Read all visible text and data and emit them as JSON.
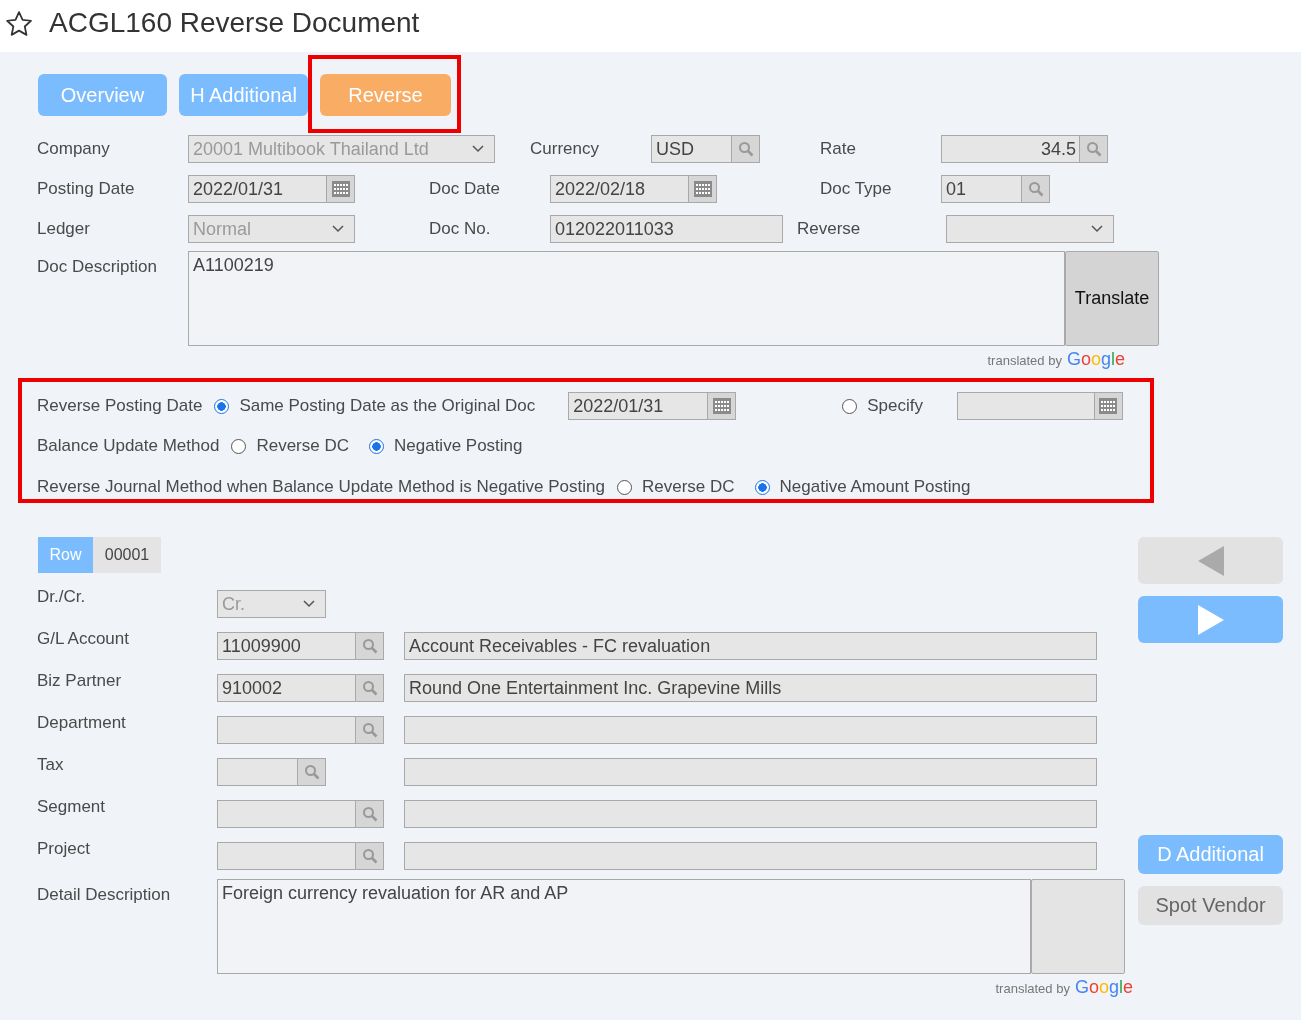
{
  "page": {
    "title": "ACGL160 Reverse Document"
  },
  "tabs": [
    {
      "label": "Overview",
      "selected": false
    },
    {
      "label": "H Additional",
      "selected": false
    },
    {
      "label": "Reverse",
      "selected": true
    }
  ],
  "header": {
    "rows": [
      [
        {
          "label": "Company",
          "kind": "select",
          "value": "20001 Multibook Thailand Ltd",
          "disabled": true
        },
        {
          "label": "Currency",
          "kind": "lookup",
          "value": "USD"
        },
        {
          "label": "Rate",
          "kind": "lookup",
          "value": "34.5"
        }
      ],
      [
        {
          "label": "Posting Date",
          "kind": "date",
          "value": "2022/01/31"
        },
        {
          "label": "Doc Date",
          "kind": "date",
          "value": "2022/02/18"
        },
        {
          "label": "Doc Type",
          "kind": "lookup",
          "value": "01"
        }
      ],
      [
        {
          "label": "Ledger",
          "kind": "select",
          "value": "Normal",
          "disabled": true
        },
        {
          "label": "Doc No.",
          "kind": "text",
          "value": "012022011033"
        },
        {
          "label": "Reverse",
          "kind": "select"
        }
      ]
    ],
    "description": {
      "label": "Doc Description",
      "value": "A1100219",
      "button": "Translate",
      "credit": "translated by",
      "logo": "Google"
    }
  },
  "reverse_options": [
    {
      "label": "Reverse Posting Date",
      "options": [
        {
          "label": "Same Posting Date as the Original Doc",
          "selected": true,
          "date": "2022/01/31"
        },
        {
          "label": "Specify",
          "selected": false
        }
      ]
    },
    {
      "label": "Balance Update Method",
      "options": [
        {
          "label": "Reverse DC",
          "selected": false
        },
        {
          "label": "Negative Posting",
          "selected": true
        }
      ]
    },
    {
      "label": "Reverse Journal Method when Balance Update Method is Negative Posting",
      "options": [
        {
          "label": "Reverse DC",
          "selected": false
        },
        {
          "label": "Negative Amount Posting",
          "selected": true
        }
      ]
    }
  ],
  "detail": {
    "row_label": "Row",
    "row_number": "00001",
    "fields": [
      {
        "label": "Dr./Cr.",
        "kind": "select",
        "value": "Cr.",
        "disabled": true
      },
      {
        "label": "G/L Account",
        "kind": "lookup",
        "value": "11009900",
        "name": "Account Receivables - FC revaluation"
      },
      {
        "label": "Biz Partner",
        "kind": "lookup",
        "value": "910002",
        "name": "Round One Entertainment Inc. Grapevine Mills"
      },
      {
        "label": "Department",
        "kind": "lookup"
      },
      {
        "label": "Tax",
        "kind": "short_lookup"
      },
      {
        "label": "Segment",
        "kind": "lookup"
      },
      {
        "label": "Project",
        "kind": "lookup"
      }
    ],
    "description": {
      "label": "Detail Description",
      "value": "Foreign currency revaluation for AR and AP",
      "credit": "translated by",
      "logo": "Google"
    }
  },
  "side_buttons": [
    {
      "kind": "prev",
      "disabled": true
    },
    {
      "kind": "next",
      "disabled": false
    },
    {
      "kind": "text",
      "label": "D Additional",
      "disabled": false
    },
    {
      "kind": "text",
      "label": "Spot Vendor",
      "disabled": true
    }
  ]
}
